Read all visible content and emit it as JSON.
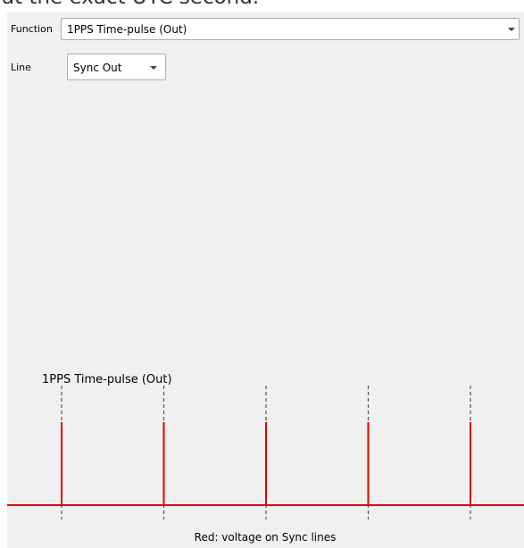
{
  "top_caption": "at the exact UTC second.",
  "function_row": {
    "label": "Function",
    "value": "1PPS Time-pulse (Out)",
    "arrow_icon": "chevron-down-icon"
  },
  "line_row": {
    "label": "Line",
    "value": "Sync Out",
    "arrow_icon": "chevron-down-icon"
  },
  "diagram": {
    "title": "1PPS Time-pulse (Out)",
    "caption": "Red: voltage on Sync lines",
    "pulse_count": 5,
    "signal_color": "#e00000",
    "marker_color": "#555555"
  }
}
